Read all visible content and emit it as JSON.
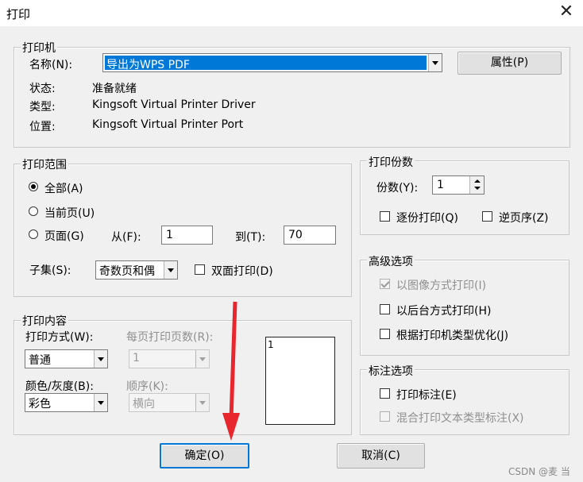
{
  "window": {
    "title": "打印",
    "close_glyph": "✕"
  },
  "printer": {
    "legend": "打印机",
    "name_label": "名称(N):",
    "name_value": "导出为WPS PDF",
    "properties_button": "属性(P)",
    "status_label": "状态:",
    "status_value": "准备就绪",
    "type_label": "类型:",
    "type_value": "Kingsoft Virtual Printer Driver",
    "location_label": "位置:",
    "location_value": "Kingsoft Virtual Printer Port"
  },
  "range": {
    "legend": "打印范围",
    "all_label": "全部(A)",
    "current_label": "当前页(U)",
    "pages_label": "页面(G)",
    "from_label": "从(F):",
    "from_value": "1",
    "to_label": "到(T):",
    "to_value": "70",
    "subset_label": "子集(S):",
    "subset_value": "奇数页和偶",
    "duplex_label": "双面打印(D)"
  },
  "copies": {
    "legend": "打印份数",
    "count_label": "份数(Y):",
    "count_value": "1",
    "collate_label": "逐份打印(Q)",
    "reverse_label": "逆页序(Z)"
  },
  "advanced": {
    "legend": "高级选项",
    "image_mode_label": "以图像方式打印(I)",
    "background_label": "以后台方式打印(H)",
    "optimize_label": "根据打印机类型优化(J)"
  },
  "content": {
    "legend": "打印内容",
    "mode_label": "打印方式(W):",
    "mode_value": "普通",
    "pages_per_sheet_label": "每页打印页数(R):",
    "pages_per_sheet_value": "1",
    "color_label": "颜色/灰度(B):",
    "color_value": "彩色",
    "order_label": "顺序(K):",
    "order_value": "横向",
    "preview_number": "1"
  },
  "annotation": {
    "legend": "标注选项",
    "print_annotations_label": "打印标注(E)",
    "mixed_label": "混合打印文本类型标注(X)"
  },
  "buttons": {
    "ok": "确定(O)",
    "cancel": "取消(C)"
  },
  "watermark": "CSDN @麦 当",
  "colors": {
    "selection": "#0078d7",
    "annotation_arrow": "#e8262d"
  }
}
